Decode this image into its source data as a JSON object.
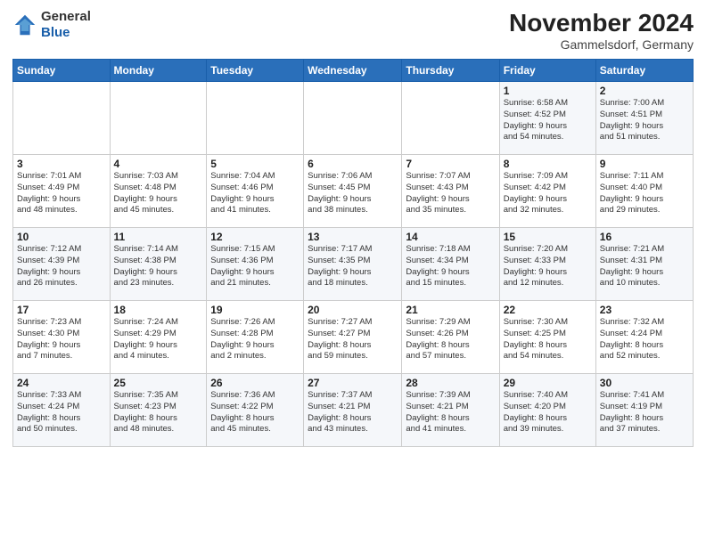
{
  "header": {
    "logo": {
      "line1": "General",
      "line2": "Blue"
    },
    "title": "November 2024",
    "location": "Gammelsdorf, Germany"
  },
  "weekdays": [
    "Sunday",
    "Monday",
    "Tuesday",
    "Wednesday",
    "Thursday",
    "Friday",
    "Saturday"
  ],
  "weeks": [
    [
      {
        "day": "",
        "info": ""
      },
      {
        "day": "",
        "info": ""
      },
      {
        "day": "",
        "info": ""
      },
      {
        "day": "",
        "info": ""
      },
      {
        "day": "",
        "info": ""
      },
      {
        "day": "1",
        "info": "Sunrise: 6:58 AM\nSunset: 4:52 PM\nDaylight: 9 hours\nand 54 minutes."
      },
      {
        "day": "2",
        "info": "Sunrise: 7:00 AM\nSunset: 4:51 PM\nDaylight: 9 hours\nand 51 minutes."
      }
    ],
    [
      {
        "day": "3",
        "info": "Sunrise: 7:01 AM\nSunset: 4:49 PM\nDaylight: 9 hours\nand 48 minutes."
      },
      {
        "day": "4",
        "info": "Sunrise: 7:03 AM\nSunset: 4:48 PM\nDaylight: 9 hours\nand 45 minutes."
      },
      {
        "day": "5",
        "info": "Sunrise: 7:04 AM\nSunset: 4:46 PM\nDaylight: 9 hours\nand 41 minutes."
      },
      {
        "day": "6",
        "info": "Sunrise: 7:06 AM\nSunset: 4:45 PM\nDaylight: 9 hours\nand 38 minutes."
      },
      {
        "day": "7",
        "info": "Sunrise: 7:07 AM\nSunset: 4:43 PM\nDaylight: 9 hours\nand 35 minutes."
      },
      {
        "day": "8",
        "info": "Sunrise: 7:09 AM\nSunset: 4:42 PM\nDaylight: 9 hours\nand 32 minutes."
      },
      {
        "day": "9",
        "info": "Sunrise: 7:11 AM\nSunset: 4:40 PM\nDaylight: 9 hours\nand 29 minutes."
      }
    ],
    [
      {
        "day": "10",
        "info": "Sunrise: 7:12 AM\nSunset: 4:39 PM\nDaylight: 9 hours\nand 26 minutes."
      },
      {
        "day": "11",
        "info": "Sunrise: 7:14 AM\nSunset: 4:38 PM\nDaylight: 9 hours\nand 23 minutes."
      },
      {
        "day": "12",
        "info": "Sunrise: 7:15 AM\nSunset: 4:36 PM\nDaylight: 9 hours\nand 21 minutes."
      },
      {
        "day": "13",
        "info": "Sunrise: 7:17 AM\nSunset: 4:35 PM\nDaylight: 9 hours\nand 18 minutes."
      },
      {
        "day": "14",
        "info": "Sunrise: 7:18 AM\nSunset: 4:34 PM\nDaylight: 9 hours\nand 15 minutes."
      },
      {
        "day": "15",
        "info": "Sunrise: 7:20 AM\nSunset: 4:33 PM\nDaylight: 9 hours\nand 12 minutes."
      },
      {
        "day": "16",
        "info": "Sunrise: 7:21 AM\nSunset: 4:31 PM\nDaylight: 9 hours\nand 10 minutes."
      }
    ],
    [
      {
        "day": "17",
        "info": "Sunrise: 7:23 AM\nSunset: 4:30 PM\nDaylight: 9 hours\nand 7 minutes."
      },
      {
        "day": "18",
        "info": "Sunrise: 7:24 AM\nSunset: 4:29 PM\nDaylight: 9 hours\nand 4 minutes."
      },
      {
        "day": "19",
        "info": "Sunrise: 7:26 AM\nSunset: 4:28 PM\nDaylight: 9 hours\nand 2 minutes."
      },
      {
        "day": "20",
        "info": "Sunrise: 7:27 AM\nSunset: 4:27 PM\nDaylight: 8 hours\nand 59 minutes."
      },
      {
        "day": "21",
        "info": "Sunrise: 7:29 AM\nSunset: 4:26 PM\nDaylight: 8 hours\nand 57 minutes."
      },
      {
        "day": "22",
        "info": "Sunrise: 7:30 AM\nSunset: 4:25 PM\nDaylight: 8 hours\nand 54 minutes."
      },
      {
        "day": "23",
        "info": "Sunrise: 7:32 AM\nSunset: 4:24 PM\nDaylight: 8 hours\nand 52 minutes."
      }
    ],
    [
      {
        "day": "24",
        "info": "Sunrise: 7:33 AM\nSunset: 4:24 PM\nDaylight: 8 hours\nand 50 minutes."
      },
      {
        "day": "25",
        "info": "Sunrise: 7:35 AM\nSunset: 4:23 PM\nDaylight: 8 hours\nand 48 minutes."
      },
      {
        "day": "26",
        "info": "Sunrise: 7:36 AM\nSunset: 4:22 PM\nDaylight: 8 hours\nand 45 minutes."
      },
      {
        "day": "27",
        "info": "Sunrise: 7:37 AM\nSunset: 4:21 PM\nDaylight: 8 hours\nand 43 minutes."
      },
      {
        "day": "28",
        "info": "Sunrise: 7:39 AM\nSunset: 4:21 PM\nDaylight: 8 hours\nand 41 minutes."
      },
      {
        "day": "29",
        "info": "Sunrise: 7:40 AM\nSunset: 4:20 PM\nDaylight: 8 hours\nand 39 minutes."
      },
      {
        "day": "30",
        "info": "Sunrise: 7:41 AM\nSunset: 4:19 PM\nDaylight: 8 hours\nand 37 minutes."
      }
    ]
  ]
}
